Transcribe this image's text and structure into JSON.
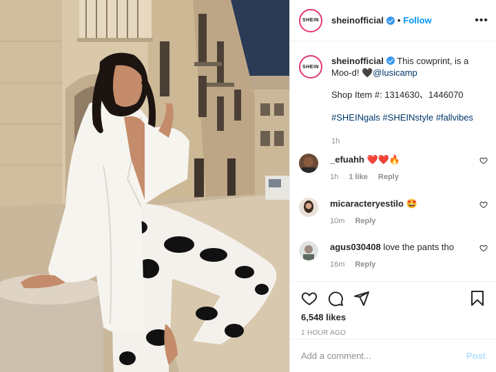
{
  "header": {
    "username": "sheinofficial",
    "avatar_text": "SHEIN",
    "separator": "•",
    "follow_label": "Follow",
    "more_label": "•••"
  },
  "caption": {
    "username": "sheinofficial",
    "text": " This cowprint, is a Moo-d! ",
    "emoji": "🖤",
    "mention": "@lusicamp",
    "shop_line": "Shop Item #: 1314630、1446070",
    "hashtags": "#SHEINgals #SHEINstyle #fallvibes",
    "time": "1h"
  },
  "comments": [
    {
      "username": "_efuahh",
      "text": " ❤️❤️🔥",
      "time": "1h",
      "likes": "1 like",
      "reply_label": "Reply"
    },
    {
      "username": "micaracteryestilo",
      "text": " 🤩",
      "time": "10m",
      "likes": "",
      "reply_label": "Reply"
    },
    {
      "username": "agus030408",
      "text": " love the pants tho",
      "time": "16m",
      "likes": "",
      "reply_label": "Reply"
    }
  ],
  "actions": {
    "likes": "6,548 likes",
    "posted": "1 HOUR AGO"
  },
  "add_comment": {
    "placeholder": "Add a comment...",
    "post_label": "Post"
  },
  "colors": {
    "link_blue": "#0095f6",
    "hashtag_blue": "#00376b",
    "muted": "#8e8e8e",
    "avatar_ring": "#e4386d",
    "verified": "#3897f0"
  }
}
